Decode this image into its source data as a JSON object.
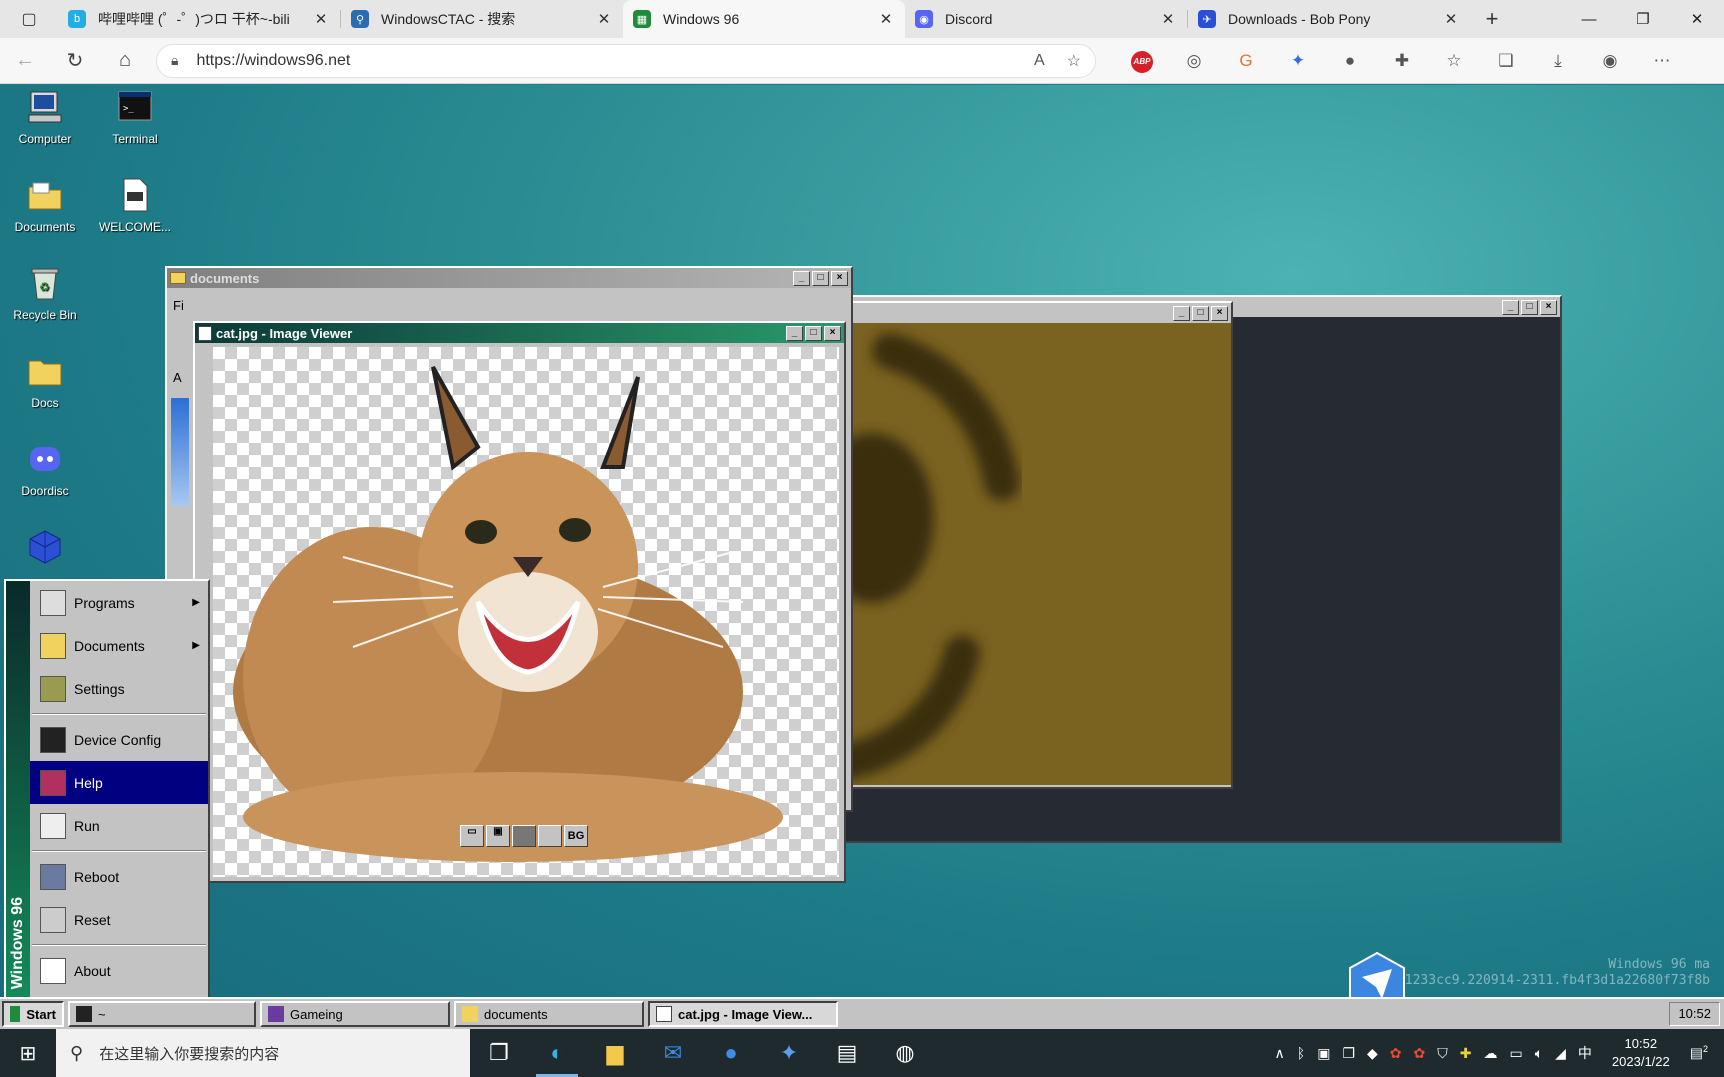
{
  "browser": {
    "tabs": [
      {
        "title": "哔哩哔哩 (゜-゜)つロ 干杯~-bili",
        "fav_color": "#23ade5",
        "fav": "b"
      },
      {
        "title": "WindowsCTAC - 搜索",
        "fav_color": "#2b6cb0",
        "fav": "⚲"
      },
      {
        "title": "Windows 96",
        "fav_color": "#1e8c3a",
        "fav": "▦"
      },
      {
        "title": "Discord",
        "fav_color": "#5865f2",
        "fav": "◉"
      },
      {
        "title": "Downloads - Bob Pony",
        "fav_color": "#2a4fd6",
        "fav": "✈"
      }
    ],
    "url": "https://windows96.net",
    "abp_label": "ABP"
  },
  "desktop": {
    "icons": [
      {
        "label": "Computer"
      },
      {
        "label": "Terminal"
      },
      {
        "label": "Documents"
      },
      {
        "label": "WELCOME..."
      },
      {
        "label": "Recycle Bin"
      },
      {
        "label": "Docs"
      },
      {
        "label": "Doordisc"
      }
    ]
  },
  "windows": {
    "documents_title": "documents",
    "documents_menu": "Fi",
    "documents_addr": "A",
    "viewer_title": "cat.jpg - Image Viewer",
    "viewer_bg_button": "BG",
    "watermark_line1": "Windows 96 ma",
    "watermark_line2": "Build 1233cc9.220914-2311.fb4f3d1a22680f73f8b"
  },
  "start_menu": {
    "band_text": "Windows 96",
    "items": [
      {
        "label": "Programs"
      },
      {
        "label": "Documents"
      },
      {
        "label": "Settings"
      },
      {
        "label": "Device Config"
      },
      {
        "label": "Help"
      },
      {
        "label": "Run"
      },
      {
        "label": "Reboot"
      },
      {
        "label": "Reset"
      },
      {
        "label": "About"
      }
    ]
  },
  "w96_taskbar": {
    "start_label": "Start",
    "buttons": [
      {
        "label": "~"
      },
      {
        "label": "Gameing"
      },
      {
        "label": "documents"
      },
      {
        "label": "cat.jpg - Image View..."
      }
    ],
    "clock": "10:52"
  },
  "os_taskbar": {
    "search_placeholder": "在这里输入你要搜索的内容",
    "ime": "中",
    "time": "10:52",
    "date": "2023/1/22",
    "notif_count": "2"
  }
}
